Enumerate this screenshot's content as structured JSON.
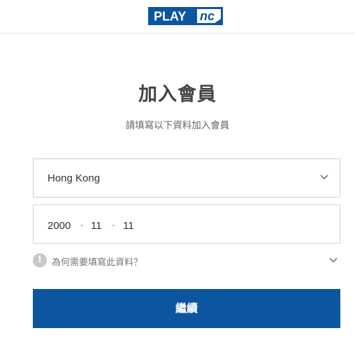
{
  "header": {
    "logo_text_left": "PLAY",
    "logo_text_right": "nc",
    "brand_color": "#0c56a0"
  },
  "page": {
    "title": "加入會員",
    "subtitle": "請填寫以下資料加入會員"
  },
  "form": {
    "country": {
      "value": "Hong Kong",
      "icon": "chevron-down-icon"
    },
    "birthdate": {
      "year": "2000",
      "month": "11",
      "day": "11",
      "separator": "-"
    },
    "help": {
      "icon": "exclamation-icon",
      "text": "為何需要填寫此資料？",
      "toggle_icon": "chevron-down-icon"
    },
    "continue_label": "繼續"
  }
}
